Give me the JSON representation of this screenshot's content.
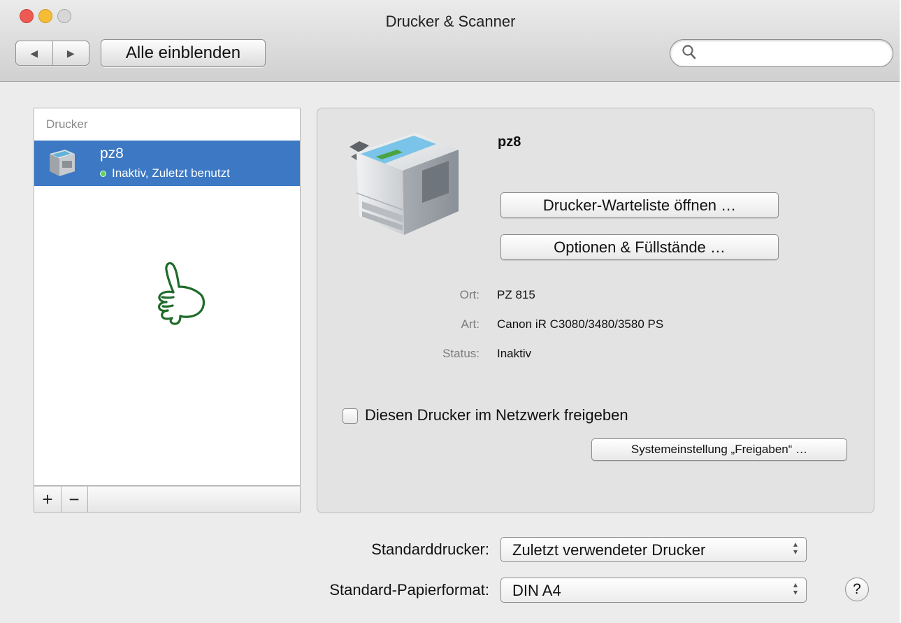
{
  "window": {
    "title": "Drucker & Scanner",
    "traffic_lights": {
      "close": "#ee5a52",
      "minimize": "#f5bd34",
      "zoom": "#d7d7d7"
    }
  },
  "toolbar": {
    "back_icon": "◀",
    "forward_icon": "▶",
    "show_all_label": "Alle einblenden",
    "search_placeholder": "",
    "search_value": ""
  },
  "sidebar": {
    "header": "Drucker",
    "items": [
      {
        "name": "pz8",
        "status": "Inaktiv, Zuletzt benutzt",
        "selected": true
      }
    ],
    "add_label": "+",
    "remove_label": "−"
  },
  "detail": {
    "name": "pz8",
    "open_queue_label": "Drucker-Warteliste öffnen …",
    "options_label": "Optionen & Füllstände …",
    "fields": [
      {
        "label": "Ort:",
        "value": "PZ 815"
      },
      {
        "label": "Art:",
        "value": "Canon iR C3080/3480/3580 PS"
      },
      {
        "label": "Status:",
        "value": "Inaktiv"
      }
    ],
    "share_label": "Diesen Drucker im Netzwerk freigeben",
    "share_checked": false,
    "sharing_prefs_label": "Systemeinstellung „Freigaben“ …"
  },
  "bottom": {
    "default_printer_label": "Standarddrucker:",
    "default_printer_value": "Zuletzt verwendeter Drucker",
    "paper_size_label": "Standard-Papierformat:",
    "paper_size_value": "DIN A4",
    "help_label": "?"
  },
  "colors": {
    "selection": "#3c78c3",
    "thumb_annotation": "#1f6b2a"
  }
}
